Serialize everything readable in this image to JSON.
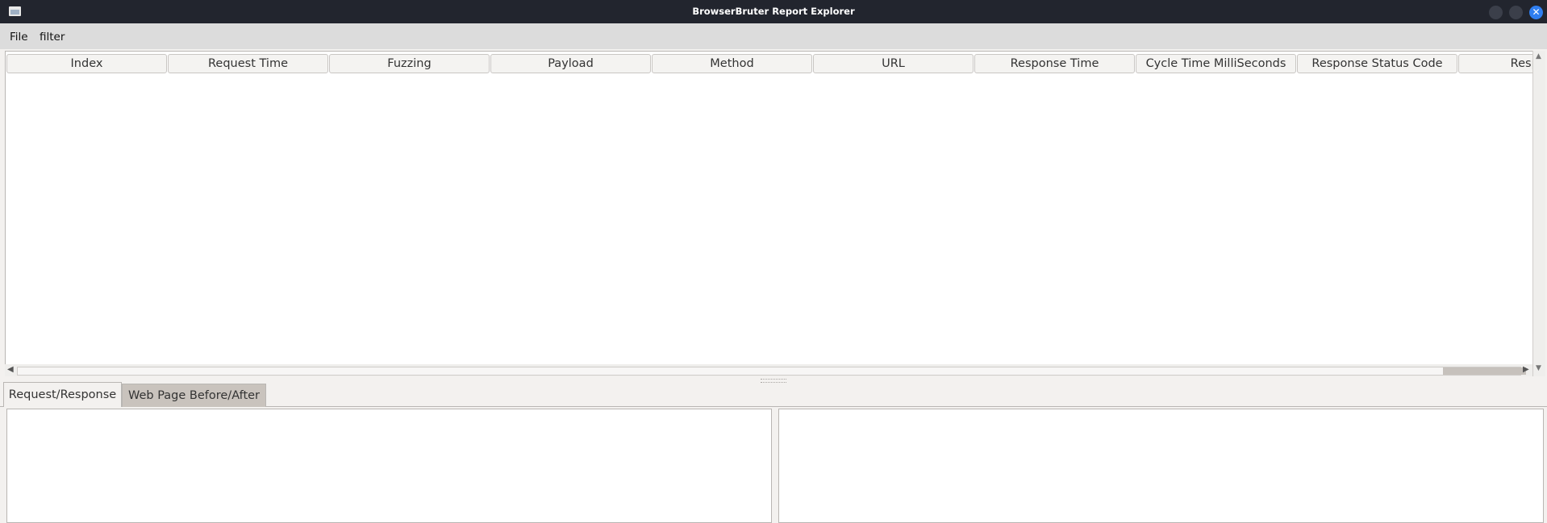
{
  "window": {
    "title": "BrowserBruter Report Explorer",
    "close_glyph": "✕"
  },
  "menu": {
    "file": "File",
    "filter": "filter"
  },
  "table": {
    "columns": [
      "Index",
      "Request Time",
      "Fuzzing",
      "Payload",
      "Method",
      "URL",
      "Response Time",
      "Cycle Time MilliSeconds",
      "Response Status Code",
      "Response"
    ],
    "rows": []
  },
  "scrollbars": {
    "up_arrow": "▲",
    "down_arrow": "▼",
    "left_arrow": "◀",
    "right_arrow": "▶"
  },
  "tabs": [
    {
      "label": "Request/Response",
      "active": true
    },
    {
      "label": "Web Page Before/After",
      "active": false
    }
  ],
  "icons": {
    "window": "app-window-icon",
    "minimize": "minimize-icon",
    "maximize": "maximize-icon",
    "close": "close-icon"
  },
  "colors": {
    "titlebar": "#22252e",
    "close_button": "#2f7ef0",
    "inactive_tab": "#c9c3bd"
  }
}
